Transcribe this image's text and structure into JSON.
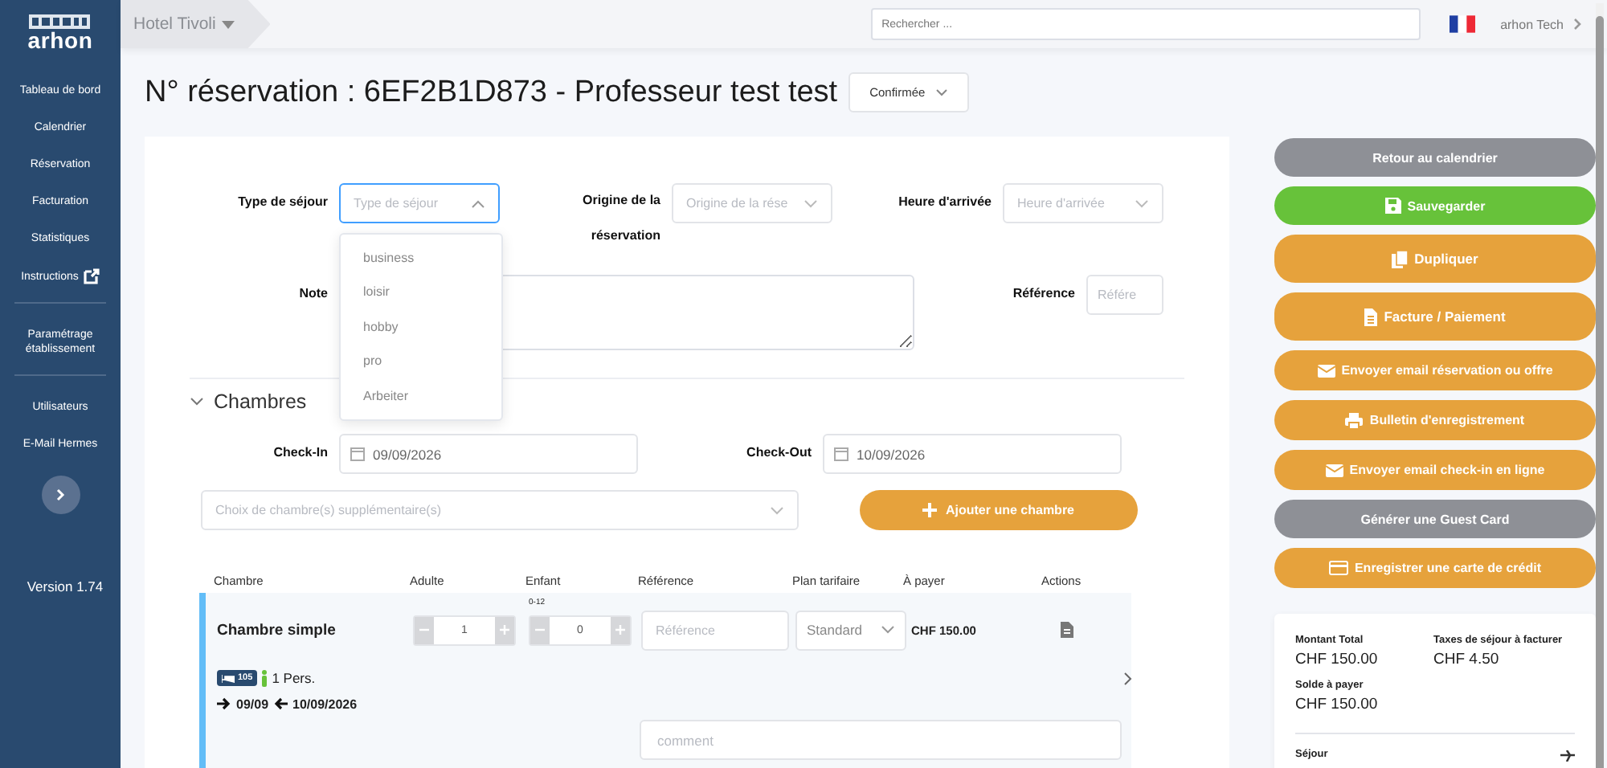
{
  "sidebar": {
    "brand": "arhon",
    "groups": [
      [
        {
          "label": "Tableau de bord",
          "external": false
        },
        {
          "label": "Calendrier",
          "external": false
        },
        {
          "label": "Réservation",
          "external": false
        },
        {
          "label": "Facturation",
          "external": false
        },
        {
          "label": "Statistiques",
          "external": false
        },
        {
          "label": "Instructions",
          "external": true
        }
      ],
      [
        {
          "label": "Paramétrage établissement",
          "external": false
        }
      ],
      [
        {
          "label": "Utilisateurs",
          "external": false
        },
        {
          "label": "E-Mail Hermes",
          "external": false
        }
      ]
    ],
    "version": "Version 1.74"
  },
  "topbar": {
    "hotel": "Hotel Tivoli",
    "search_placeholder": "Rechercher ...",
    "user": "arhon Tech"
  },
  "title": "N° réservation : 6EF2B1D873 - Professeur test test",
  "status": "Confirmée",
  "form": {
    "stay_type": {
      "label": "Type de séjour",
      "placeholder": "Type de séjour",
      "expanded": true,
      "options": [
        {
          "label": "business",
          "selected": false
        },
        {
          "label": "loisir",
          "selected": false
        },
        {
          "label": "hobby",
          "selected": false
        },
        {
          "label": "pro",
          "selected": false
        },
        {
          "label": "Arbeiter",
          "selected": false
        }
      ]
    },
    "origin": {
      "label": "Origine de la réservation",
      "placeholder": "Origine de la rése"
    },
    "arrival": {
      "label": "Heure d'arrivée",
      "placeholder": "Heure d'arrivée"
    },
    "note": {
      "label": "Note"
    },
    "reference": {
      "label": "Référence",
      "placeholder": "Référe"
    }
  },
  "rooms": {
    "title": "Chambres",
    "expanded": true,
    "checkin": {
      "label": "Check-In",
      "value": "09/09/2026"
    },
    "checkout": {
      "label": "Check-Out",
      "value": "10/09/2026"
    },
    "room_choice_placeholder": "Choix de chambre(s) supplémentaire(s)",
    "add_button": "Ajouter une chambre",
    "columns": [
      "Chambre",
      "Adulte",
      "Enfant",
      "Référence",
      "Plan tarifaire",
      "À payer",
      "Actions"
    ],
    "rows": [
      {
        "name": "Chambre simple",
        "adults": "1",
        "children": "0",
        "children_range": "0-12",
        "reference_placeholder": "Référence",
        "rate_plan": "Standard",
        "amount": "CHF 150.00",
        "room_number": "105",
        "persons": "1 Pers.",
        "arrival": "09/09",
        "departure": "10/09/2026",
        "comment_placeholder": "comment"
      }
    ]
  },
  "actions": [
    {
      "label": "Retour au calendrier",
      "kind": "plain",
      "color": "#8e9096"
    },
    {
      "label": "Sauvegarder",
      "kind": "save",
      "color": "#67c23a"
    },
    {
      "label": "Dupliquer",
      "kind": "copy",
      "color": "#e6a23c"
    },
    {
      "label": "Facture / Paiement",
      "kind": "invoice",
      "color": "#e6a23c"
    },
    {
      "label": "Envoyer email réservation ou offre",
      "kind": "mail",
      "color": "#e6a23c"
    },
    {
      "label": "Bulletin d'enregistrement",
      "kind": "print",
      "color": "#e6a23c"
    },
    {
      "label": "Envoyer email check-in en ligne",
      "kind": "mail",
      "color": "#e6a23c"
    },
    {
      "label": "Générer une Guest Card",
      "kind": "plain",
      "color": "#8e9096"
    },
    {
      "label": "Enregistrer une carte de crédit",
      "kind": "card",
      "color": "#e6a23c"
    }
  ],
  "summary": {
    "total_label": "Montant Total",
    "total": "CHF 150.00",
    "tax_label": "Taxes de séjour à facturer",
    "tax": "CHF 4.50",
    "balance_label": "Solde à payer",
    "balance": "CHF 150.00",
    "stay_label": "Séjour"
  }
}
